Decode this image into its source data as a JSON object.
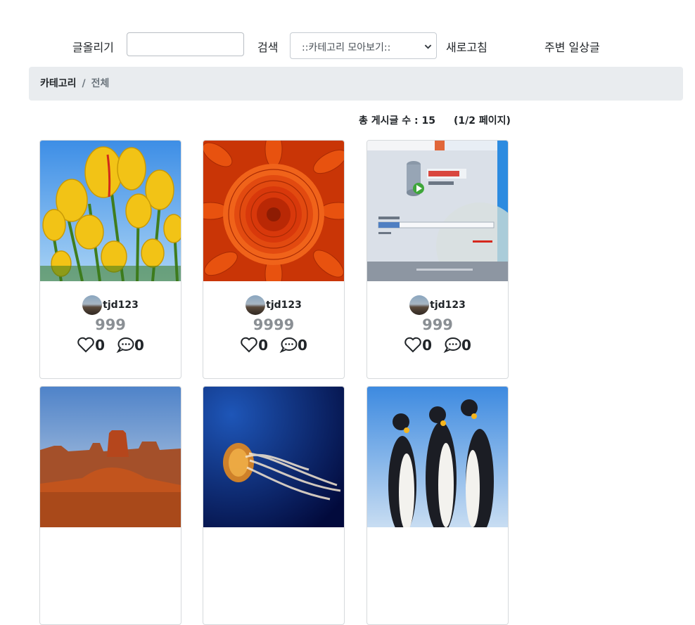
{
  "nav": {
    "write_label": "글올리기",
    "search_label": "검색",
    "category_select": "::카테고리 모아보기::",
    "refresh_label": "새로고침",
    "nearby_label": "주변 일상글"
  },
  "breadcrumb": {
    "root": "카테고리",
    "separator": "/",
    "current": "전체"
  },
  "summary": {
    "post_count": "총 게시글 수 : 15",
    "page_info": "(1/2 페이지)"
  },
  "posts": [
    {
      "author": "tjd123",
      "views": "999",
      "likes": "0",
      "comments": "0",
      "thumbnail": "yellow-tulips"
    },
    {
      "author": "tjd123",
      "views": "9999",
      "likes": "0",
      "comments": "0",
      "thumbnail": "orange-chrysanthemum"
    },
    {
      "author": "tjd123",
      "views": "999",
      "likes": "0",
      "comments": "0",
      "thumbnail": "oracle-sql-developer-splash"
    },
    {
      "author": "",
      "views": "",
      "likes": "",
      "comments": "",
      "thumbnail": "desert-buttes"
    },
    {
      "author": "",
      "views": "",
      "likes": "",
      "comments": "",
      "thumbnail": "jellyfish"
    },
    {
      "author": "",
      "views": "",
      "likes": "",
      "comments": "",
      "thumbnail": "penguins"
    }
  ],
  "icons": [
    "heart-icon",
    "comment-icon",
    "chevron-down-icon"
  ],
  "colors": {
    "breadcrumb_bg": "#e9ecef",
    "views_text": "#8a8f94",
    "oracle_red": "#d5281e"
  }
}
